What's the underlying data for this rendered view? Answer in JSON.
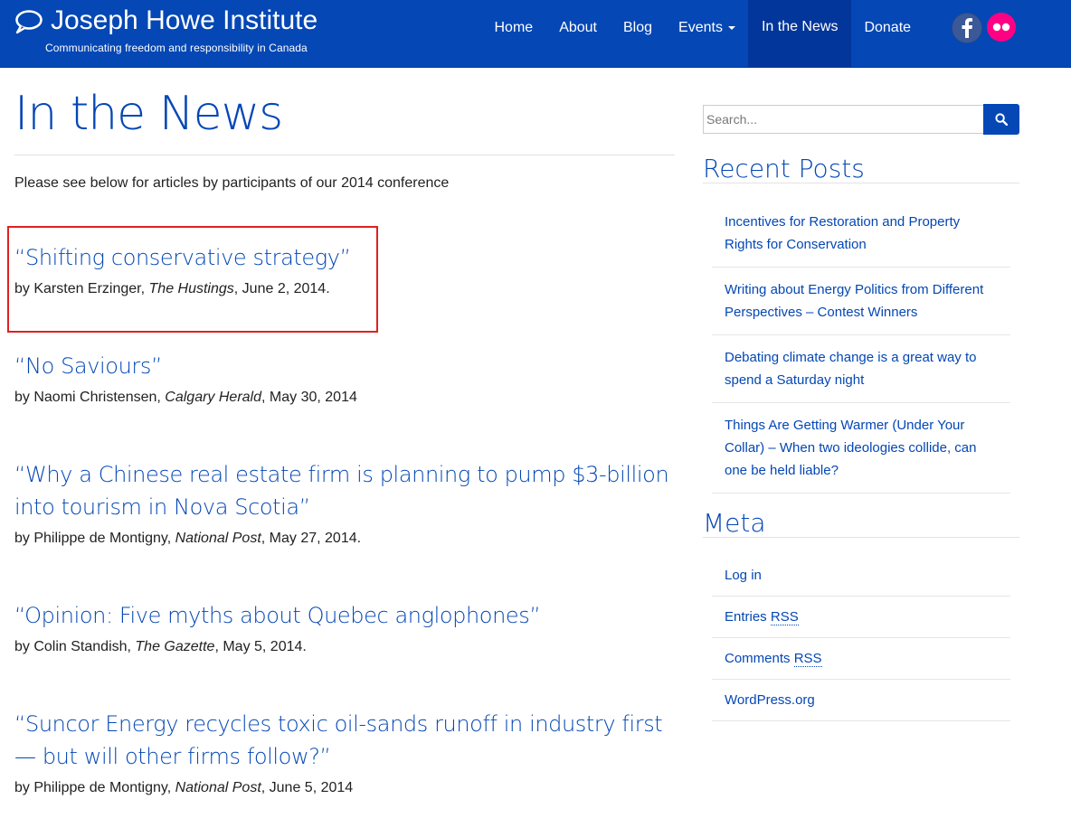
{
  "header": {
    "site_title": "Joseph Howe Institute",
    "tagline": "Communicating freedom and responsibility in Canada",
    "nav": [
      {
        "label": "Home"
      },
      {
        "label": "About"
      },
      {
        "label": "Blog"
      },
      {
        "label": "Events"
      },
      {
        "label": "In the News"
      },
      {
        "label": "Donate"
      }
    ],
    "social": {
      "facebook": "facebook-icon",
      "flickr": "flickr-icon"
    }
  },
  "main": {
    "page_title": "In the News",
    "intro": "Please see below for articles by participants of our 2014 conference",
    "articles": [
      {
        "title": "“Shifting conservative strategy”",
        "by": "by Karsten Erzinger, ",
        "publication": "The Hustings",
        "date": ", June 2, 2014."
      },
      {
        "title": "“No Saviours”",
        "by": "by Naomi Christensen, ",
        "publication": "Calgary Herald",
        "date": ", May 30, 2014"
      },
      {
        "title": "“Why a Chinese real estate firm is planning to pump $3-billion into tourism in Nova Scotia”",
        "by": "by Philippe de Montigny, ",
        "publication": "National Post",
        "date": ", May 27, 2014."
      },
      {
        "title": "“Opinion: Five myths about Quebec anglophones”",
        "by": "by Colin Standish, ",
        "publication": "The Gazette",
        "date": ", May 5, 2014."
      },
      {
        "title": "“Suncor Energy recycles toxic oil-sands runoff in industry first — but will other firms follow?”",
        "by": "by Philippe de Montigny, ",
        "publication": "National Post",
        "date": ", June 5, 2014"
      }
    ]
  },
  "sidebar": {
    "search_placeholder": "Search...",
    "recent_posts_title": "Recent Posts",
    "recent_posts": [
      {
        "label": "Incentives for Restoration and Property Rights for Conservation"
      },
      {
        "label": "Writing about Energy Politics from Different Perspectives – Contest Winners"
      },
      {
        "label": "Debating climate change is a great way to spend a Saturday night"
      },
      {
        "label": "Things Are Getting Warmer (Under Your Collar) – When two ideologies collide, can one be held liable?"
      }
    ],
    "meta_title": "Meta",
    "meta": {
      "login": "Log in",
      "entries": "Entries ",
      "comments": "Comments ",
      "rss": "RSS",
      "wordpress": "WordPress.org"
    }
  },
  "colors": {
    "brand": "#0447b5",
    "nav_active": "#03369a",
    "highlight": "#e02020"
  }
}
